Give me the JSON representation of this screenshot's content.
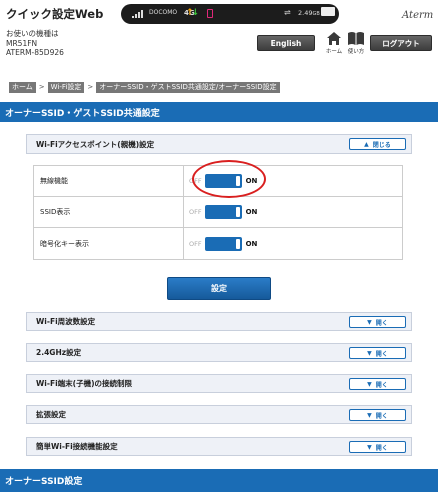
{
  "header": {
    "app_title": "クイック設定Web",
    "device_info": [
      "お使いの機種は",
      "MR51FN",
      "ATERM-85D926"
    ],
    "status": {
      "carrier": "DOCOMO",
      "network": "4G",
      "data_usage": "2.49",
      "data_unit": "GB",
      "battery": "BATT"
    },
    "brand": "Aterm",
    "english_button": "English",
    "home_label": "ホーム",
    "help_label": "使い方",
    "logout_button": "ログアウト"
  },
  "breadcrumb": [
    "ホーム",
    "Wi-Fi設定",
    "オーナーSSID・ゲストSSID共通設定/オーナーSSID設定"
  ],
  "section_title": "オーナーSSID・ゲストSSID共通設定",
  "ap_panel": {
    "title": "Wi-Fiアクセスポイント(親機)設定",
    "close_label": "閉じる"
  },
  "settings": [
    {
      "label": "無線機能",
      "off": "OFF",
      "on": "ON",
      "enabled": true
    },
    {
      "label": "SSID表示",
      "off": "OFF",
      "on": "ON",
      "enabled": true
    },
    {
      "label": "暗号化キー表示",
      "off": "OFF",
      "on": "ON",
      "enabled": true
    }
  ],
  "submit_label": "設定",
  "accordions": [
    {
      "title": "Wi-Fi周波数設定",
      "button": "開く"
    },
    {
      "title": "2.4GHz設定",
      "button": "開く"
    },
    {
      "title": "Wi-Fi端末(子機)の接続制限",
      "button": "開く"
    },
    {
      "title": "拡張設定",
      "button": "開く"
    },
    {
      "title": "簡単Wi-Fi接続機能設定",
      "button": "開く"
    }
  ],
  "owner_section_title": "オーナーSSID設定",
  "colors": {
    "accent": "#1a6cb5",
    "highlight": "#d91f1f"
  }
}
